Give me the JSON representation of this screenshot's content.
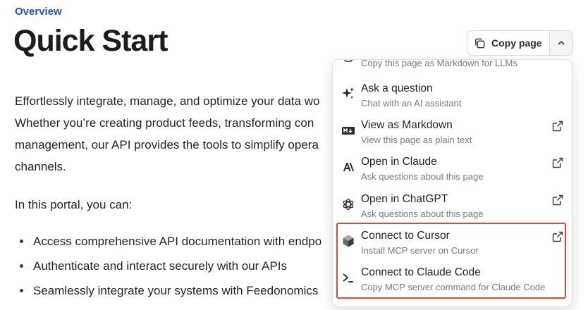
{
  "breadcrumb": "Overview",
  "title": "Quick Start",
  "intro_lines": [
    "Effortlessly integrate, manage, and optimize your data wo",
    "Whether you’re creating product feeds, transforming con",
    "management, our API provides the tools to simplify opera",
    "channels."
  ],
  "portal_text": "In this portal, you can:",
  "bullets": [
    "Access comprehensive API documentation with endpo",
    "Authenticate and interact securely with our APIs",
    "Seamlessly integrate your systems with Feedonomics"
  ],
  "copy_button": {
    "label": "Copy page",
    "icon": "copy-icon",
    "dropdown_icon": "chevron-up-icon"
  },
  "menu": {
    "partial_item": {
      "desc": "Copy this page as Markdown for LLMs"
    },
    "items": [
      {
        "title": "Ask a question",
        "desc": "Chat with an AI assistant",
        "icon": "sparkles-icon",
        "external": false
      },
      {
        "title": "View as Markdown",
        "desc": "View this page as plain text",
        "icon": "markdown-icon",
        "external": true
      },
      {
        "title": "Open in Claude",
        "desc": "Ask questions about this page",
        "icon": "anthropic-icon",
        "external": true
      },
      {
        "title": "Open in ChatGPT",
        "desc": "Ask questions about this page",
        "icon": "openai-icon",
        "external": true
      },
      {
        "title": "Connect to Cursor",
        "desc": "Install MCP server on Cursor",
        "icon": "cursor-icon",
        "external": true
      },
      {
        "title": "Connect to Claude Code",
        "desc": "Copy MCP server command for Claude Code",
        "icon": "terminal-icon",
        "external": false
      }
    ]
  },
  "colors": {
    "link": "#1a56c9",
    "highlight": "#e24444"
  }
}
